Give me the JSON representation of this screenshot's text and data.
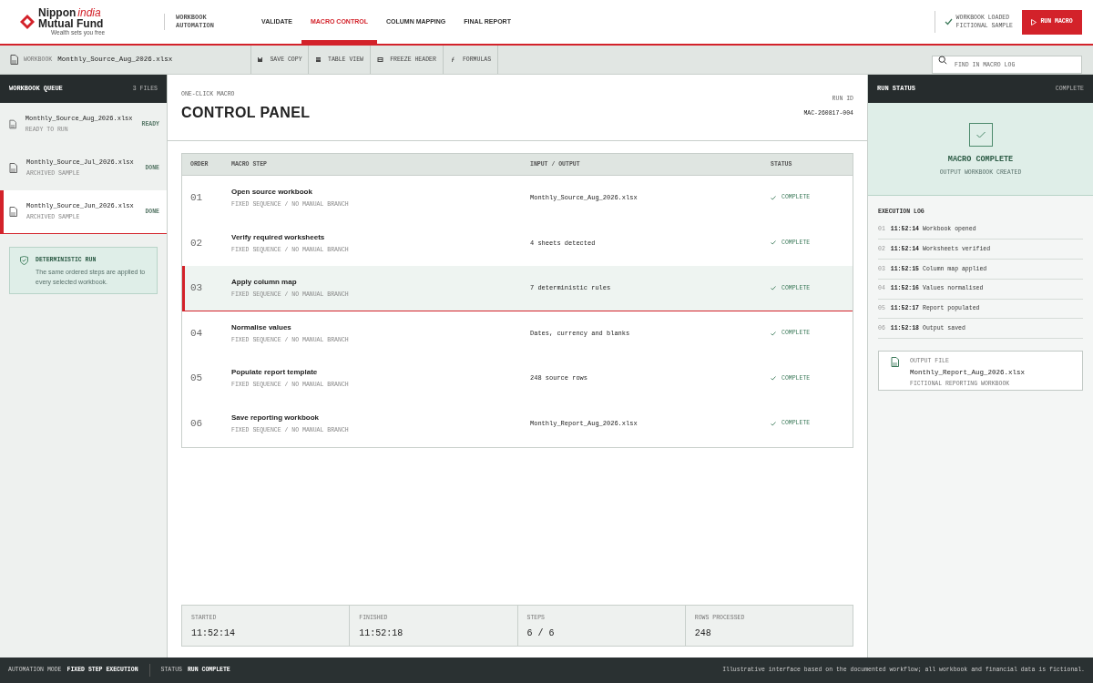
{
  "brand": {
    "name_1": "Nippon",
    "name_2": "india",
    "name_3": "Mutual Fund",
    "tagline": "Wealth sets you free"
  },
  "app_title": [
    "WORKBOOK",
    "AUTOMATION"
  ],
  "nav_tabs": [
    {
      "label": "VALIDATE",
      "selected": false
    },
    {
      "label": "MACRO CONTROL",
      "selected": true
    },
    {
      "label": "COLUMN MAPPING",
      "selected": false
    },
    {
      "label": "FINAL REPORT",
      "selected": false
    }
  ],
  "load_status": [
    "WORKBOOK LOADED",
    "FICTIONAL SAMPLE"
  ],
  "run_button": "RUN MACRO",
  "toolbar": {
    "workbook_label": "WORKBOOK",
    "workbook_name": "Monthly_Source_Aug_2026.xlsx",
    "tools": [
      {
        "label": "SAVE COPY",
        "kind": "save"
      },
      {
        "label": "TABLE VIEW",
        "kind": "table"
      },
      {
        "label": "FREEZE HEADER",
        "kind": "freeze"
      },
      {
        "label": "FORMULAS",
        "kind": "formula"
      }
    ],
    "search": {
      "placeholder": "FIND IN MACRO LOG"
    }
  },
  "queue": {
    "title": "WORKBOOK QUEUE",
    "count": "3 FILES",
    "items": [
      {
        "file": "Monthly_Source_Aug_2026.xlsx",
        "note": "READY TO RUN",
        "state": "READY",
        "selected": false
      },
      {
        "file": "Monthly_Source_Jul_2026.xlsx",
        "note": "ARCHIVED SAMPLE",
        "state": "DONE",
        "selected": false
      },
      {
        "file": "Monthly_Source_Jun_2026.xlsx",
        "note": "ARCHIVED SAMPLE",
        "state": "DONE",
        "selected": true
      }
    ],
    "notice": {
      "title": "DETERMINISTIC RUN",
      "text": "The same ordered steps are applied to every selected workbook."
    }
  },
  "panel": {
    "eyebrow": "ONE-CLICK MACRO",
    "title": "CONTROL PANEL",
    "run_id_label": "RUN ID",
    "run_id": "MAC-260817-004"
  },
  "table": {
    "columns": [
      "ORDER",
      "MACRO STEP",
      "INPUT / OUTPUT",
      "STATUS"
    ],
    "rows": [
      {
        "order": "01",
        "step": "Open source workbook",
        "note": "FIXED SEQUENCE / NO MANUAL BRANCH",
        "io": "Monthly_Source_Aug_2026.xlsx",
        "status": "COMPLETE",
        "selected": false
      },
      {
        "order": "02",
        "step": "Verify required worksheets",
        "note": "FIXED SEQUENCE / NO MANUAL BRANCH",
        "io": "4 sheets detected",
        "status": "COMPLETE",
        "selected": false
      },
      {
        "order": "03",
        "step": "Apply column map",
        "note": "FIXED SEQUENCE / NO MANUAL BRANCH",
        "io": "7 deterministic rules",
        "status": "COMPLETE",
        "selected": true
      },
      {
        "order": "04",
        "step": "Normalise values",
        "note": "FIXED SEQUENCE / NO MANUAL BRANCH",
        "io": "Dates, currency and blanks",
        "status": "COMPLETE",
        "selected": false
      },
      {
        "order": "05",
        "step": "Populate report template",
        "note": "FIXED SEQUENCE / NO MANUAL BRANCH",
        "io": "248 source rows",
        "status": "COMPLETE",
        "selected": false
      },
      {
        "order": "06",
        "step": "Save reporting workbook",
        "note": "FIXED SEQUENCE / NO MANUAL BRANCH",
        "io": "Monthly_Report_Aug_2026.xlsx",
        "status": "COMPLETE",
        "selected": false
      }
    ]
  },
  "summary": [
    {
      "label": "STARTED",
      "value": "11:52:14"
    },
    {
      "label": "FINISHED",
      "value": "11:52:18"
    },
    {
      "label": "STEPS",
      "value": "6 / 6"
    },
    {
      "label": "ROWS PROCESSED",
      "value": "248"
    }
  ],
  "run_status": {
    "title": "RUN STATUS",
    "badge": "COMPLETE",
    "headline": "MACRO COMPLETE",
    "subline": "OUTPUT WORKBOOK CREATED",
    "log_title": "EXECUTION LOG",
    "log": [
      {
        "n": "01",
        "time": "11:52:14",
        "text": "Workbook opened"
      },
      {
        "n": "02",
        "time": "11:52:14",
        "text": "Worksheets verified"
      },
      {
        "n": "03",
        "time": "11:52:15",
        "text": "Column map applied"
      },
      {
        "n": "04",
        "time": "11:52:16",
        "text": "Values normalised"
      },
      {
        "n": "05",
        "time": "11:52:17",
        "text": "Report populated"
      },
      {
        "n": "06",
        "time": "11:52:18",
        "text": "Output saved"
      }
    ],
    "output": {
      "label": "OUTPUT FILE",
      "file": "Monthly_Report_Aug_2026.xlsx",
      "note": "FICTIONAL REPORTING WORKBOOK"
    }
  },
  "status_bar": {
    "mode_label": "AUTOMATION MODE",
    "mode": "FIXED STEP EXECUTION",
    "status_label": "STATUS",
    "status": "RUN COMPLETE",
    "disclaimer": "Illustrative interface based on the documented workflow; all workbook and financial data is fictional."
  }
}
